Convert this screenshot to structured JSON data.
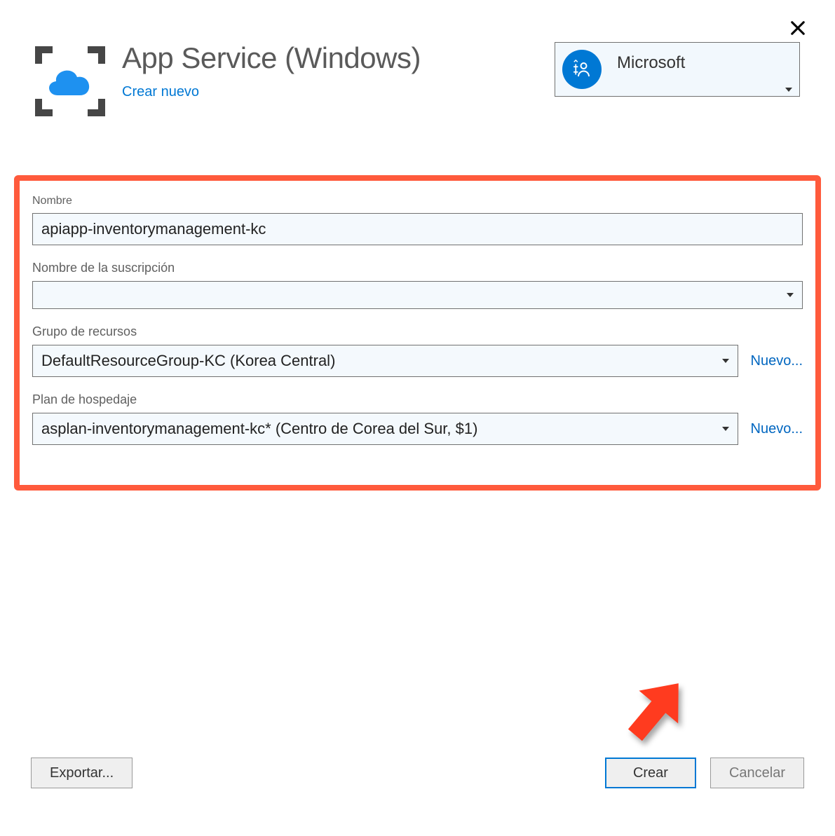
{
  "header": {
    "title": "App Service (Windows)",
    "subtitle": "Crear nuevo"
  },
  "account": {
    "name": "Microsoft"
  },
  "fields": {
    "name": {
      "label": "Nombre",
      "value": "apiapp-inventorymanagement-kc"
    },
    "subscription": {
      "label": "Nombre de la suscripción",
      "value": ""
    },
    "resource_group": {
      "label": "Grupo de recursos",
      "value": "DefaultResourceGroup-KC (Korea Central)",
      "new_link": "Nuevo..."
    },
    "hosting_plan": {
      "label": "Plan de hospedaje",
      "value": "asplan-inventorymanagement-kc* (Centro de Corea del Sur, $1)",
      "new_link": "Nuevo..."
    }
  },
  "footer": {
    "export": "Exportar...",
    "create": "Crear",
    "cancel": "Cancelar"
  }
}
